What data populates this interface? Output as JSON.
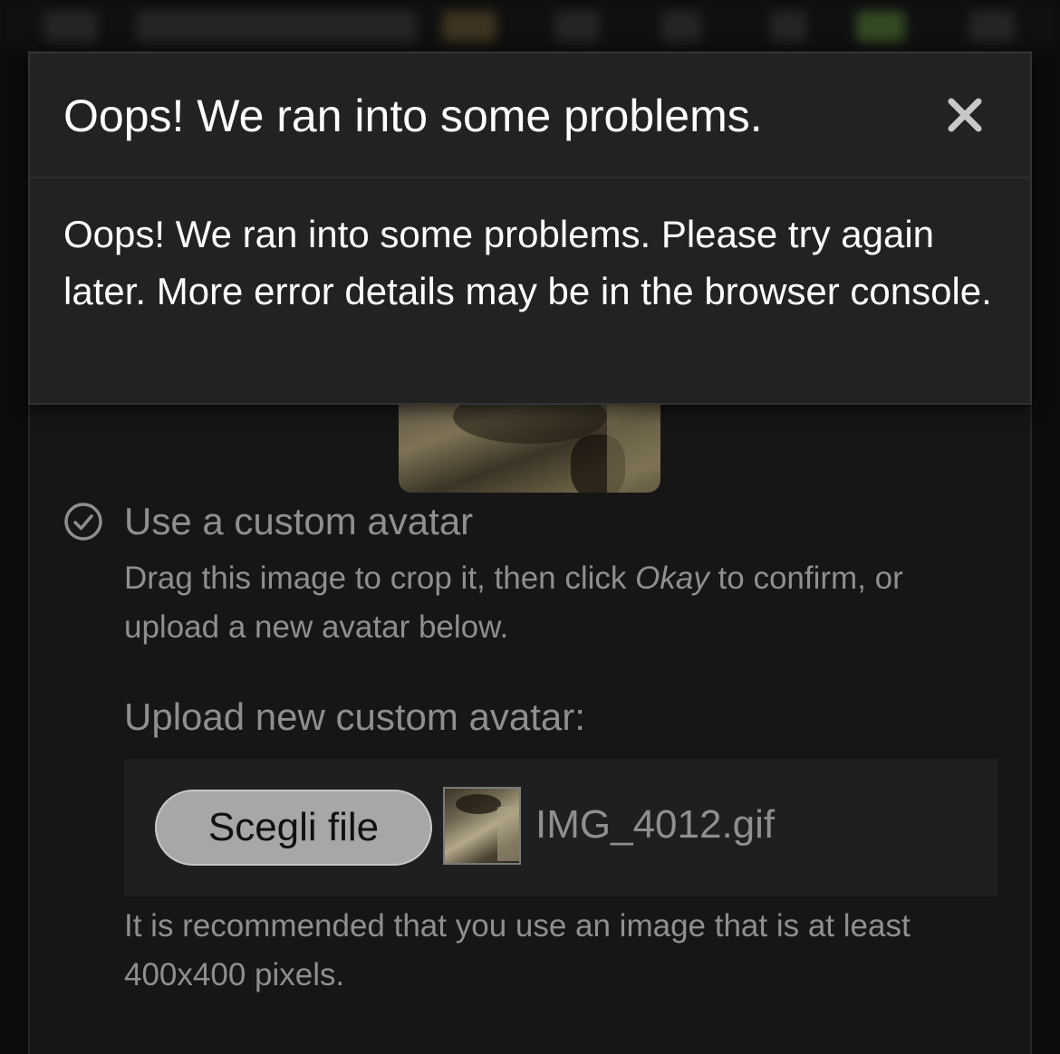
{
  "toast": {
    "title": "Oops! We ran into some problems.",
    "message": "Oops! We ran into some problems. Please try again later. More error details may be in the browser console.",
    "close_icon": "close-icon"
  },
  "avatar_option": {
    "icon": "check-circle-icon",
    "title": "Use a custom avatar",
    "desc_before": "Drag this image to crop it, then click ",
    "desc_emphasis": "Okay",
    "desc_after": " to confirm, or upload a new avatar below."
  },
  "upload": {
    "label": "Upload new custom avatar:",
    "button_label": "Scegli file",
    "file_name": "IMG_4012.gif",
    "hint": "It is recommended that you use an image that is at least 400x400 pixels."
  },
  "colors": {
    "toast_bg": "#222222",
    "dialog_bg": "#161616",
    "muted_text": "#8f8f8f",
    "button_bg": "#a7a7a7"
  }
}
